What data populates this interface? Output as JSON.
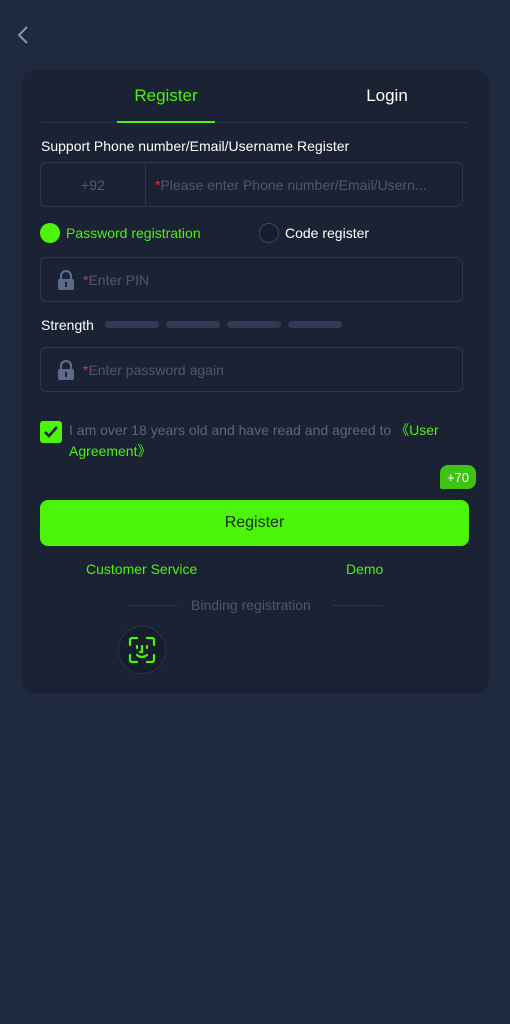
{
  "tabs": {
    "register": "Register",
    "login": "Login"
  },
  "form": {
    "support_label": "Support Phone number/Email/Username Register",
    "country_code": "+92",
    "account_required": "*",
    "account_placeholder": "Please enter Phone number/Email/Usern...",
    "options": {
      "password": "Password registration",
      "code": "Code register",
      "selected": "password"
    },
    "pin_required": "*",
    "pin_placeholder": "Enter PIN",
    "strength_label": "Strength",
    "confirm_required": "*",
    "confirm_placeholder": "Enter password again",
    "agreement_text": "I am over 18 years old and have read and agreed to ",
    "agreement_link": "《User Agreement》",
    "agreement_checked": true,
    "badge": "+70",
    "register_button": "Register"
  },
  "links": {
    "customer_service": "Customer Service",
    "demo": "Demo"
  },
  "binding": {
    "label": "Binding registration"
  },
  "icons": {
    "back": "chevron-left-icon",
    "lock": "lock-icon",
    "check": "check-icon",
    "face": "face-scan-icon"
  },
  "colors": {
    "background": "#1f2940",
    "card": "#1a2233",
    "accent": "#4cf30b",
    "required": "#e0314b",
    "placeholder": "#4b5873"
  }
}
